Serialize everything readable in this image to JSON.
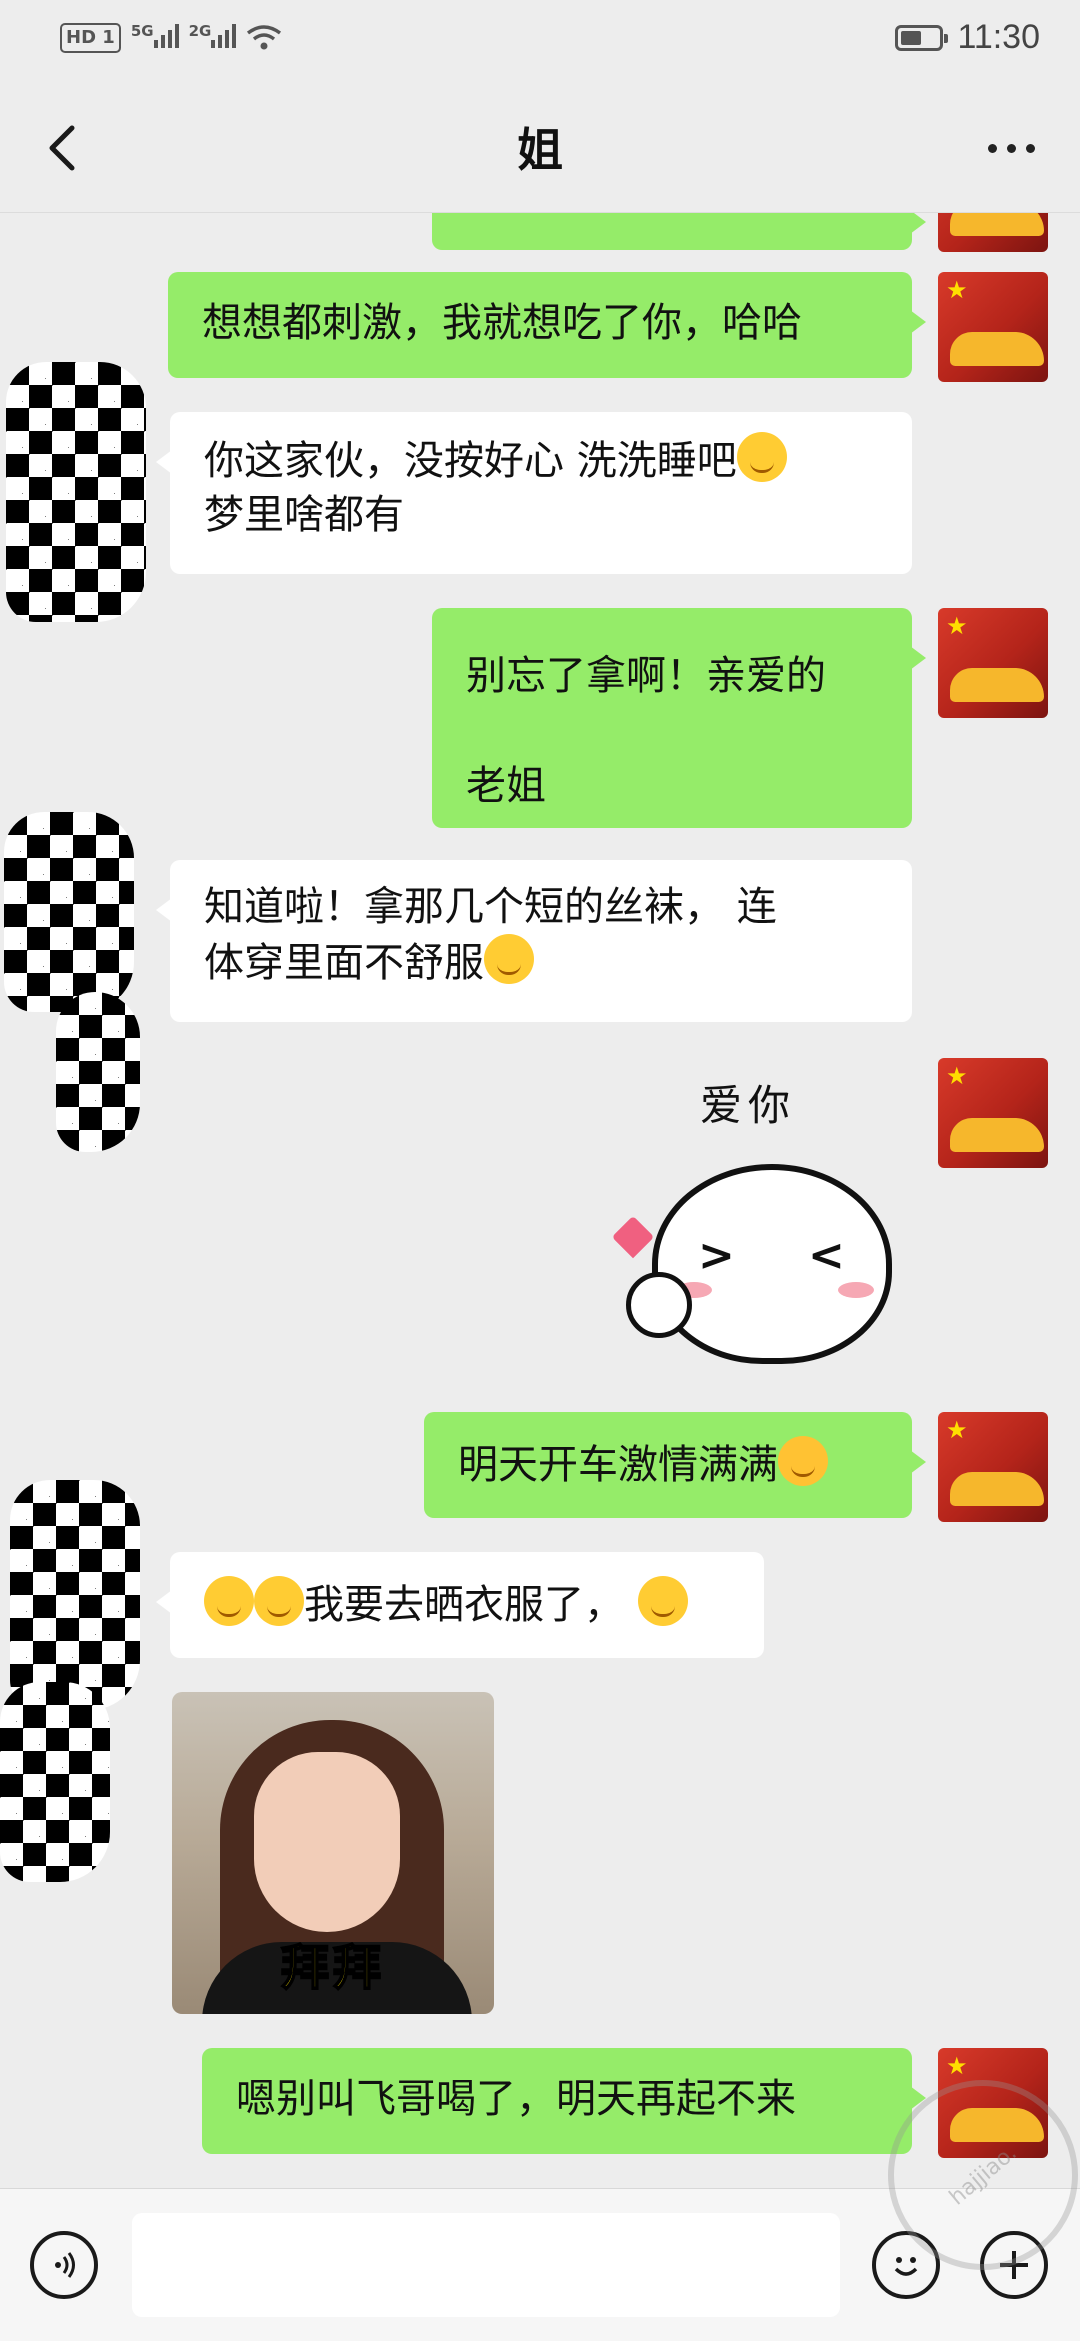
{
  "status_bar": {
    "hd": "HD",
    "sim": "1",
    "net1": "5G",
    "net2": "2G",
    "time": "11:30"
  },
  "header": {
    "title": "姐"
  },
  "messages": [
    {
      "from": "me",
      "text": "想想都刺激，我就想吃了你，哈哈"
    },
    {
      "from": "other",
      "line1": "你这家伙，没按好心  洗洗睡吧",
      "line2": "梦里啥都有"
    },
    {
      "from": "me",
      "line1": "别忘了拿啊！亲爱的",
      "line2": "老姐"
    },
    {
      "from": "other",
      "line1": "知道啦！拿那几个短的丝袜，  连",
      "line2": "体穿里面不舒服"
    },
    {
      "from": "me",
      "type": "sticker",
      "text": "爱你"
    },
    {
      "from": "me",
      "text": "明天开车激情满满"
    },
    {
      "from": "other",
      "text": "我要去晒衣服了，"
    },
    {
      "from": "other",
      "type": "image",
      "caption": "拜拜"
    },
    {
      "from": "me",
      "text": "嗯别叫飞哥喝了，明天再起不来"
    }
  ],
  "input_bar": {
    "voice_icon": "voice-icon",
    "emoji_icon": "emoji-icon",
    "plus_icon": "plus-icon"
  },
  "watermark": {
    "text": "hajjiao."
  },
  "colors": {
    "bubble_me": "#95ec69",
    "bubble_other": "#ffffff",
    "background": "#ededed"
  }
}
